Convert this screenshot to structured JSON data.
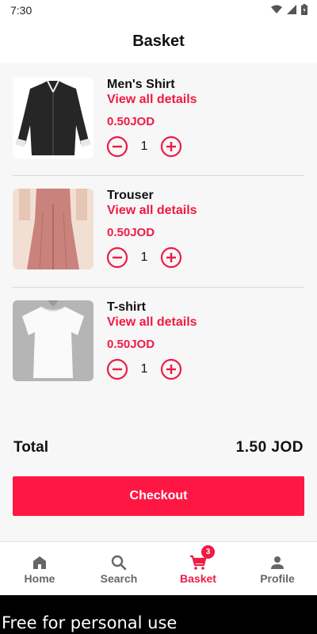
{
  "status_bar": {
    "time": "7:30"
  },
  "header": {
    "title": "Basket"
  },
  "items": [
    {
      "name": "Men's Shirt",
      "link": "View all details",
      "price": "0.50JOD",
      "qty": "1"
    },
    {
      "name": "Trouser",
      "link": "View all details",
      "price": "0.50JOD",
      "qty": "1"
    },
    {
      "name": "T-shirt",
      "link": "View all details",
      "price": "0.50JOD",
      "qty": "1"
    }
  ],
  "summary": {
    "total_label": "Total",
    "total_value": "1.50 JOD"
  },
  "checkout": {
    "label": "Checkout"
  },
  "nav": {
    "items": [
      {
        "label": "Home",
        "icon": "home-icon"
      },
      {
        "label": "Search",
        "icon": "search-icon"
      },
      {
        "label": "Basket",
        "icon": "cart-icon"
      },
      {
        "label": "Profile",
        "icon": "person-icon"
      }
    ],
    "basket_badge": "3"
  },
  "watermark": "Free for personal use",
  "colors": {
    "accent": "#ee1b45",
    "button": "#ff1744",
    "background": "#f7f7f7"
  }
}
